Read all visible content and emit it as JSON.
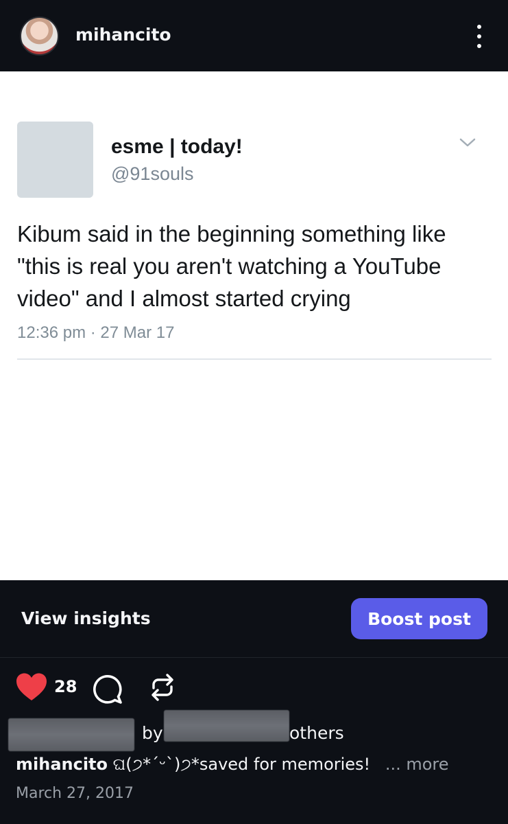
{
  "header": {
    "username": "mihancito"
  },
  "tweet": {
    "display_name": "esme | today!",
    "handle": "@91souls",
    "text": "Kibum said in the beginning something like\n\"this is real you aren't watching a YouTube\nvideo\" and I almost started crying",
    "timestamp": "12:36 pm · 27 Mar 17"
  },
  "insights": {
    "view_label": "View insights",
    "boost_label": "Boost post"
  },
  "actions": {
    "like_count": "28"
  },
  "liked_by": {
    "by_text": "by",
    "others_text": "others"
  },
  "caption": {
    "username": "mihancito",
    "text": "ଘ(੭*ˊᵕˋ)੭*saved for memories!",
    "more_label": "... more"
  },
  "post_date": "March 27, 2017",
  "colors": {
    "background": "#0d1016",
    "boost_button": "#5a5ce8",
    "heart": "#ee3f48"
  }
}
